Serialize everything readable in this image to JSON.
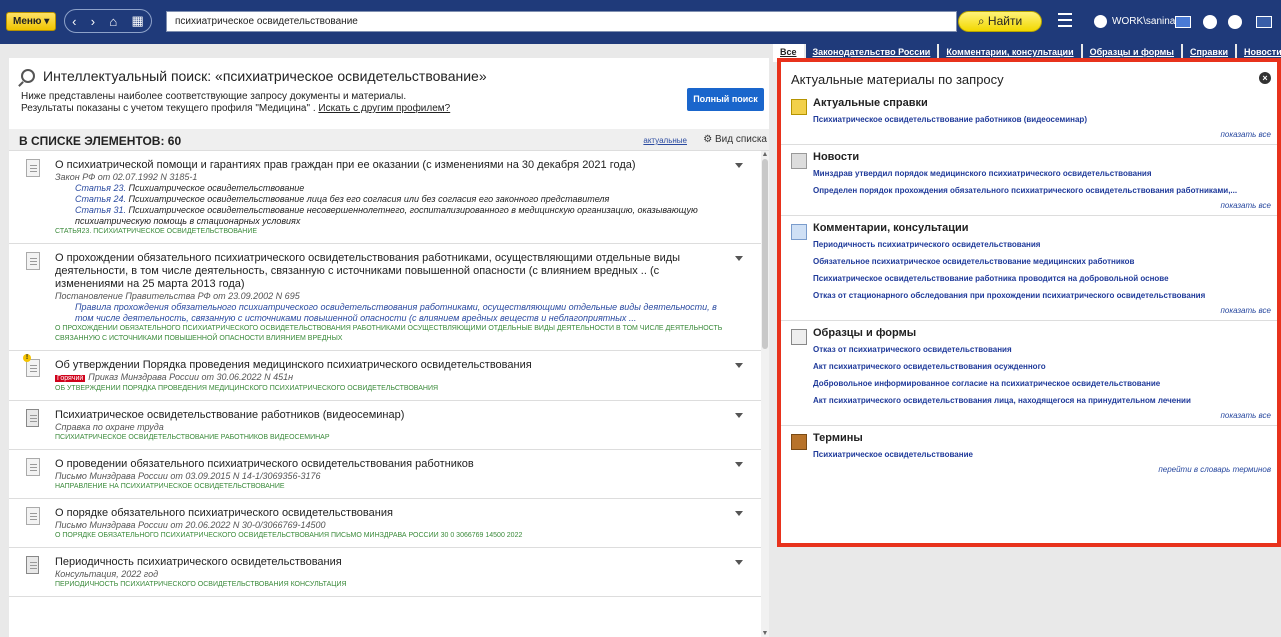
{
  "toolbar": {
    "menu_label": "Меню",
    "search_value": "психиатрическое освидетельствование",
    "find_label": "Найти",
    "user_label": "WORK\\sanina"
  },
  "tabs": [
    {
      "label": "Все"
    },
    {
      "label": "Законодательство России"
    },
    {
      "label": "Комментарии, консультации"
    },
    {
      "label": "Образцы и формы"
    },
    {
      "label": "Справки"
    },
    {
      "label": "Новости"
    }
  ],
  "search_head": {
    "title": "Интеллектуальный поиск: «психиатрическое освидетельствование»",
    "line1": "Ниже представлены наиболее соответствующие запросу документы и материалы.",
    "line2_prefix": "Результаты показаны с учетом текущего профиля \"Медицина\" .",
    "line2_link": "Искать с другим профилем?",
    "full_search": "Полный поиск"
  },
  "list_head": {
    "count": "В СПИСКЕ ЭЛЕМЕНТОВ: 60",
    "actual": "актуальные",
    "view": "Вид списка"
  },
  "docs": [
    {
      "title": "О психиатрической помощи и гарантиях прав граждан при ее оказании (с изменениями на 30 декабря 2021 года)",
      "src": "Закон РФ от 02.07.1992 N 3185-1",
      "arts": [
        {
          "link": "Статья 23.",
          "text": " Психиатрическое освидетельствование"
        },
        {
          "link": "Статья 24.",
          "text": " Психиатрическое освидетельствование лица без его согласия или без согласия его законного представителя"
        },
        {
          "link": "Статья 31.",
          "text": " Психиатрическое освидетельствование несовершеннолетнего, госпитализированного в медицинскую организацию, оказывающую психиатрическую помощь в стационарных условиях"
        }
      ],
      "kw": "СТАТЬЯ23. ПСИХИАТРИЧЕСКОЕ ОСВИДЕТЕЛЬСТВОВАНИЕ"
    },
    {
      "title": "О прохождении обязательного психиатрического освидетельствования работниками, осуществляющими отдельные виды деятельности, в том числе деятельность, связанную с источниками повышенной опасности (с влиянием вредных .. (с изменениями на 25 марта 2013 года)",
      "src": "Постановление Правительства РФ от 23.09.2002 N 695",
      "quote": "Правила прохождения обязательного психиатрического освидетельствования работниками, осуществляющими отдельные виды деятельности, в том числе деятельность, связанную с источниками повышенной опасности (с влиянием вредных веществ и неблагоприятных ...",
      "kw": "О ПРОХОЖДЕНИИ ОБЯЗАТЕЛЬНОГО ПСИХИАТРИЧЕСКОГО ОСВИДЕТЕЛЬСТВОВАНИЯ РАБОТНИКАМИ ОСУЩЕСТВЛЯЮЩИМИ ОТДЕЛЬНЫЕ ВИДЫ ДЕЯТЕЛЬНОСТИ В ТОМ ЧИСЛЕ ДЕЯТЕЛЬНОСТЬ СВЯЗАННУЮ С ИСТОЧНИКАМИ ПОВЫШЕННОЙ ОПАСНОСТИ ВЛИЯНИЕМ ВРЕДНЫХ"
    },
    {
      "title": "Об утверждении Порядка проведения медицинского психиатрического освидетельствования",
      "hot": "Горячий",
      "src": "Приказ Минздрава России от 30.06.2022 N 451н",
      "kw": "ОБ УТВЕРЖДЕНИИ ПОРЯДКА ПРОВЕДЕНИЯ МЕДИЦИНСКОГО ПСИХИАТРИЧЕСКОГО ОСВИДЕТЕЛЬСТВОВАНИЯ"
    },
    {
      "title": "Психиатрическое освидетельствование работников (видеосеминар)",
      "src": "Справка по охране труда",
      "kw": "ПСИХИАТРИЧЕСКОЕ ОСВИДЕТЕЛЬСТВОВАНИЕ РАБОТНИКОВ ВИДЕОСЕМИНАР"
    },
    {
      "title": "О проведении обязательного психиатрического освидетельствования работников",
      "src": "Письмо Минздрава России от 03.09.2015 N 14-1/3069356-3176",
      "kw": "НАПРАВЛЕНИЕ НА ПСИХИАТРИЧЕСКОЕ ОСВИДЕТЕЛЬСТВОВАНИЕ"
    },
    {
      "title": "О порядке обязательного психиатрического освидетельствования",
      "src": "Письмо Минздрава России от 20.06.2022 N 30-0/3066769-14500",
      "kw": "О ПОРЯДКЕ ОБЯЗАТЕЛЬНОГО ПСИХИАТРИЧЕСКОГО ОСВИДЕТЕЛЬСТВОВАНИЯ ПИСЬМО МИНЗДРАВА РОССИИ 30 0 3066769 14500 2022"
    },
    {
      "title": "Периодичность психиатрического освидетельствования",
      "src": "Консультация, 2022 год",
      "kw": "ПЕРИОДИЧНОСТЬ ПСИХИАТРИЧЕСКОГО ОСВИДЕТЕЛЬСТВОВАНИЯ КОНСУЛЬТАЦИЯ"
    }
  ],
  "right": {
    "title": "Актуальные материалы по запросу",
    "sections": [
      {
        "name": "Актуальные справки",
        "items": [
          "Психиатрическое освидетельствование работников (видеосеминар)"
        ],
        "more": "показать все"
      },
      {
        "name": "Новости",
        "items": [
          "Минздрав утвердил порядок медицинского психиатрического освидетельствования",
          "Определен порядок прохождения обязательного психиатрического освидетельствования работниками,..."
        ],
        "more": "показать все"
      },
      {
        "name": "Комментарии, консультации",
        "items": [
          "Периодичность психиатрического освидетельствования",
          "Обязательное психиатрическое освидетельствование медицинских работников",
          "Психиатрическое освидетельствование работника проводится на добровольной основе",
          "Отказ от стационарного обследования при прохождении психиатрического освидетельствования"
        ],
        "more": "показать все"
      },
      {
        "name": "Образцы и формы",
        "items": [
          "Отказ от психиатрического освидетельствования",
          "Акт психиатрического освидетельствования осужденного",
          "Добровольное информированное согласие на психиатрическое освидетельствование",
          "Акт психиатрического освидетельствования лица, находящегося на принудительном лечении"
        ],
        "more": "показать все"
      },
      {
        "name": "Термины",
        "items": [
          "Психиатрическое освидетельствование"
        ],
        "more": "перейти в словарь терминов"
      }
    ]
  }
}
